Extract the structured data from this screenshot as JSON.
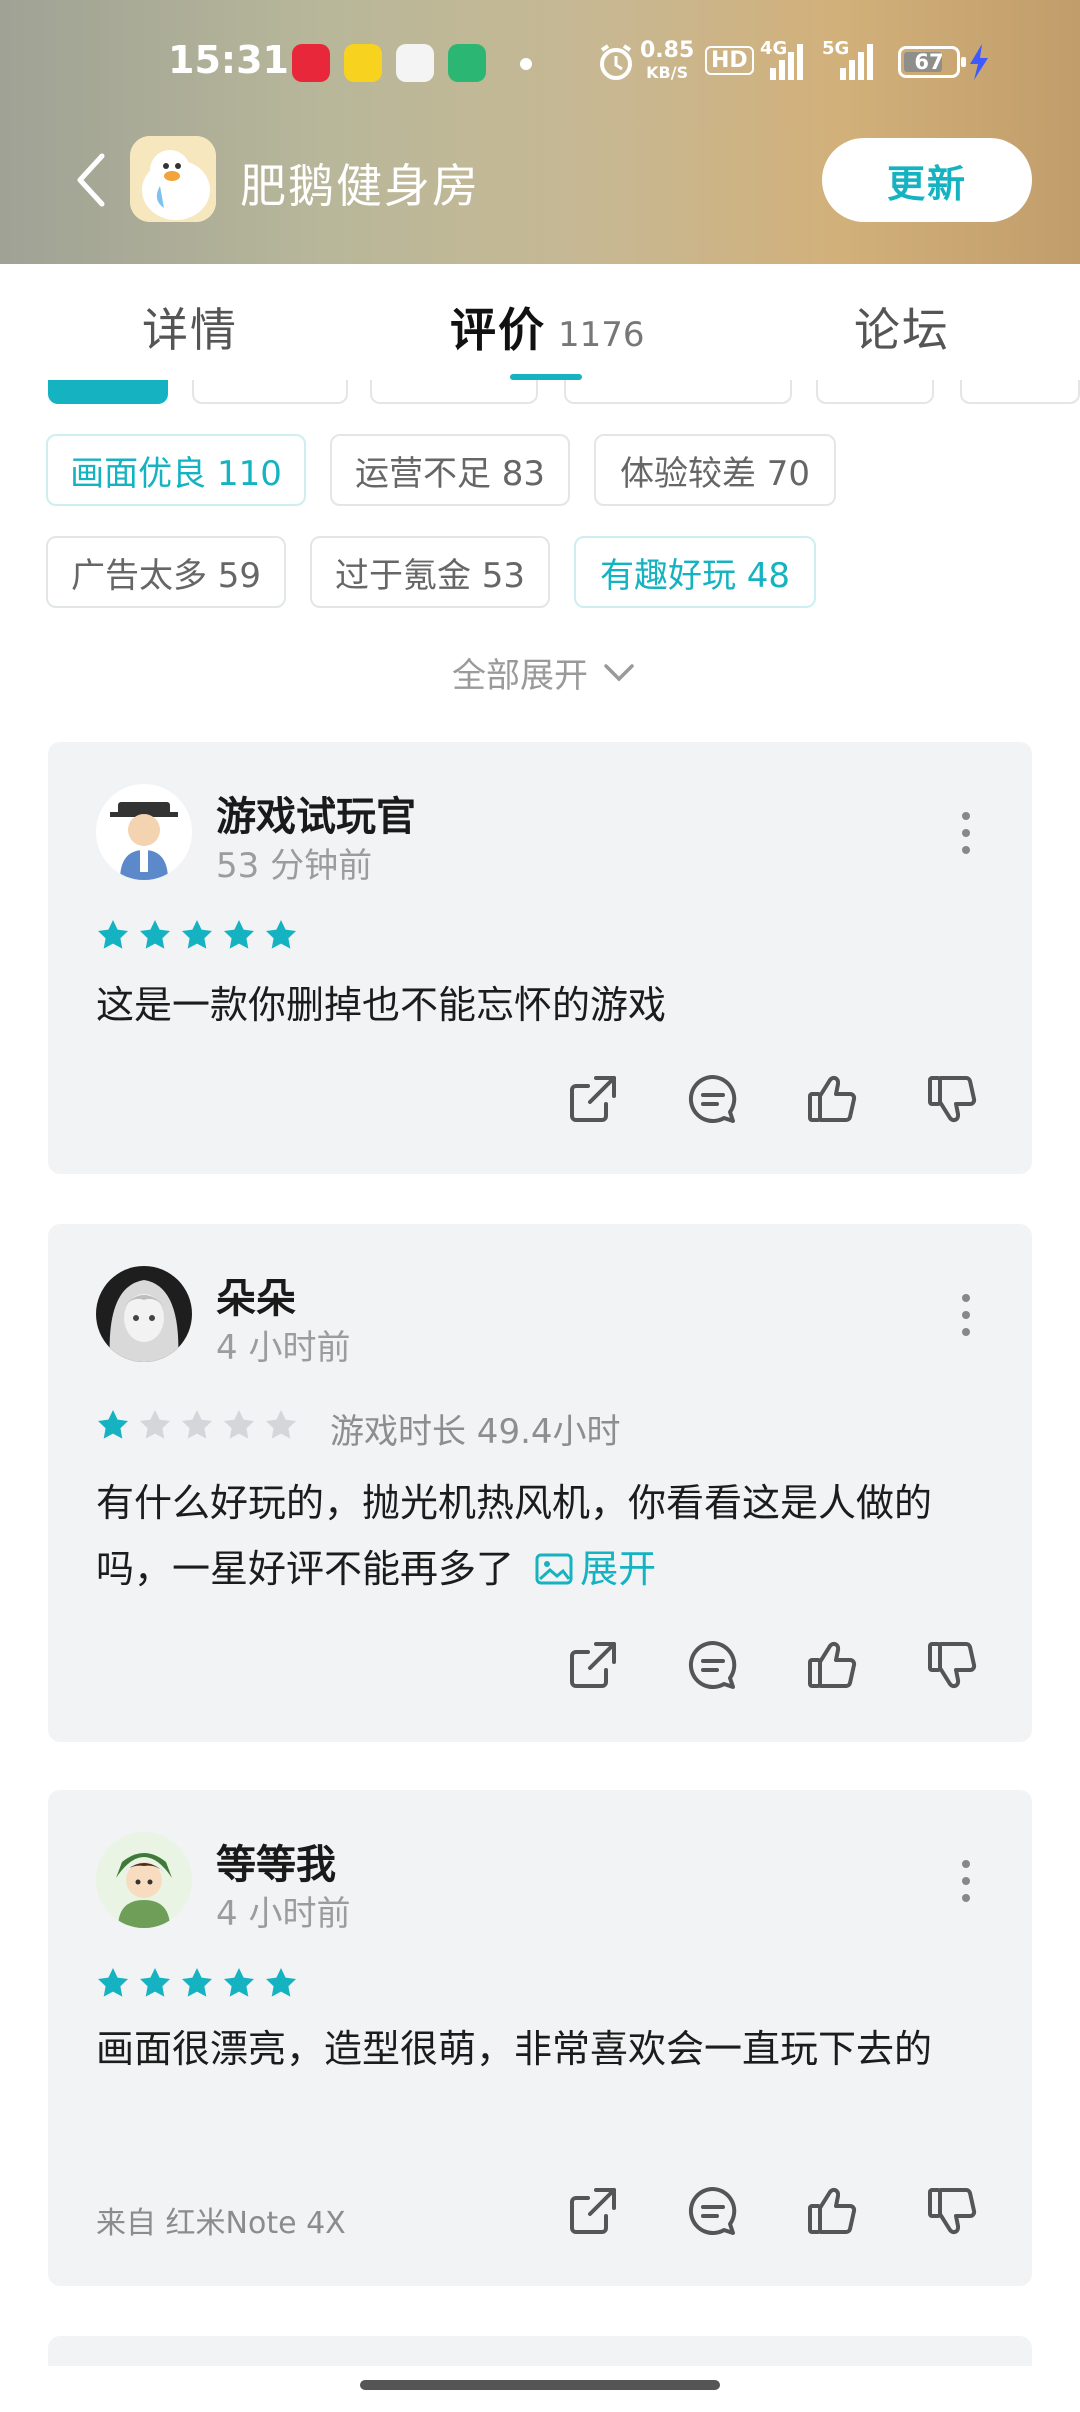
{
  "status_bar": {
    "time": "15:31",
    "net_speed_value": "0.85",
    "net_speed_unit": "KB/S",
    "hd_badge": "HD",
    "network_4g": "4G",
    "network_5g": "5G",
    "battery": "67"
  },
  "header": {
    "app_name": "肥鹅健身房",
    "update_label": "更新"
  },
  "tabs": [
    {
      "label": "详情"
    },
    {
      "label": "评价",
      "count": "1176"
    },
    {
      "label": "论坛"
    }
  ],
  "tags": [
    {
      "label": "画面优良 110",
      "highlight": true
    },
    {
      "label": "运营不足 83",
      "highlight": false
    },
    {
      "label": "体验较差 70",
      "highlight": false
    },
    {
      "label": "广告太多 59",
      "highlight": false
    },
    {
      "label": "过于氪金 53",
      "highlight": false
    },
    {
      "label": "有趣好玩 48",
      "highlight": true
    }
  ],
  "expand_all": "全部展开",
  "reviews": [
    {
      "user": "游戏试玩官",
      "time": "53 分钟前",
      "rating": 5,
      "text": "这是一款你删掉也不能忘怀的游戏"
    },
    {
      "user": "朵朵",
      "time": "4 小时前",
      "rating": 1,
      "playtime": "游戏时长 49.4小时",
      "text": "有什么好玩的，抛光机热风机，你看看这是人做的吗，一星好评不能再多了",
      "expand_label": "展开"
    },
    {
      "user": "等等我",
      "time": "4 小时前",
      "rating": 5,
      "text": "画面很漂亮，造型很萌，非常喜欢会一直玩下去的",
      "device": "来自 红米Note 4X"
    }
  ],
  "colors": {
    "accent": "#15b3c1",
    "card_bg": "#f2f3f5",
    "star_off": "#d4d6da"
  }
}
